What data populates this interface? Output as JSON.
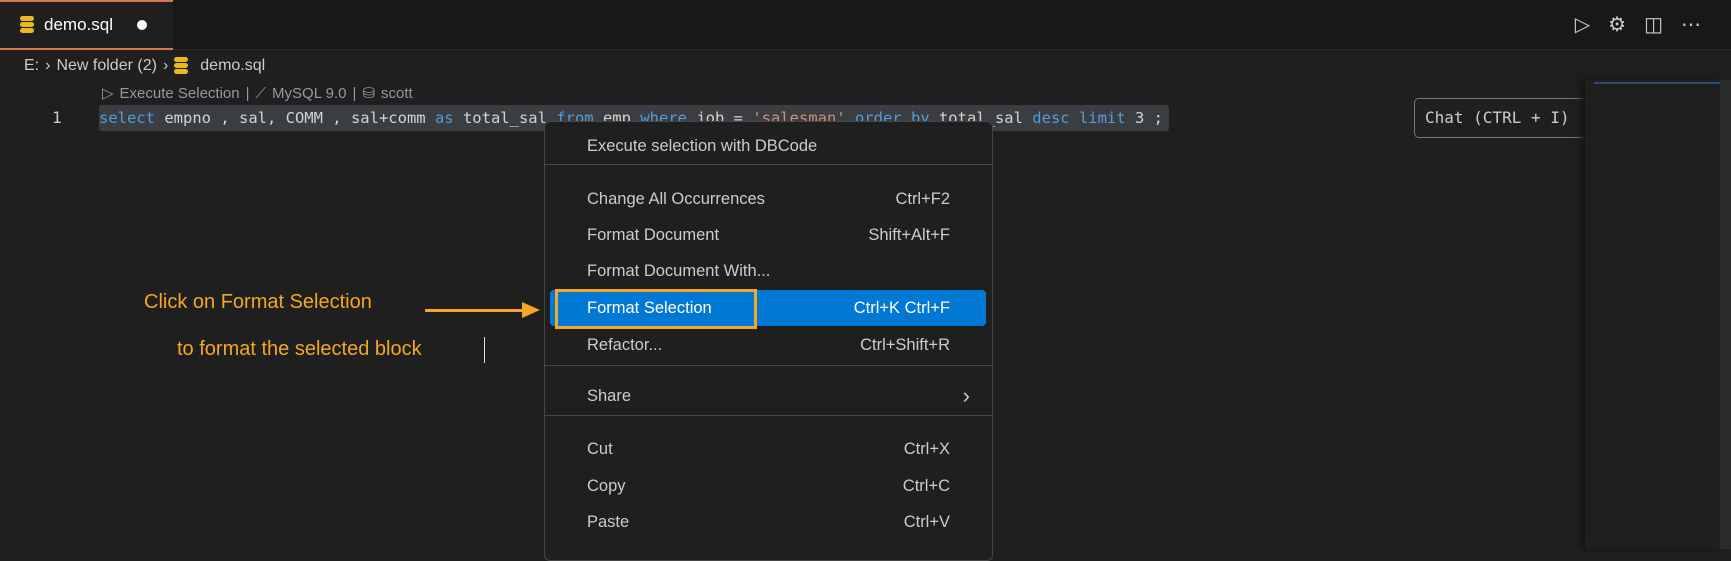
{
  "tab": {
    "title": "demo.sql",
    "icon": "database-icon",
    "modified": true
  },
  "actions": {
    "run": "play-icon",
    "settings": "gear-icon",
    "split": "split-editor-icon",
    "more": "more-icon"
  },
  "breadcrumb": [
    "E:",
    "New folder (2)",
    "demo.sql"
  ],
  "codelens": {
    "execute": "Execute Selection",
    "db": "MySQL 9.0",
    "user": "scott"
  },
  "editor": {
    "line_number": "1",
    "tokens": [
      [
        "kw",
        "select"
      ],
      [
        "id",
        " empno , sal, COMM , sal+comm "
      ],
      [
        "kw",
        "as"
      ],
      [
        "id",
        " total_sal "
      ],
      [
        "kw",
        "from"
      ],
      [
        "id",
        " emp "
      ],
      [
        "kw",
        "where"
      ],
      [
        "id",
        " job = "
      ],
      [
        "str",
        "'salesman'"
      ],
      [
        "id",
        " "
      ],
      [
        "kw",
        "order by"
      ],
      [
        "id",
        " total_sal "
      ],
      [
        "kw",
        "desc limit"
      ],
      [
        "id",
        " 3 ;"
      ]
    ]
  },
  "chat_hint": "Chat (CTRL + I)",
  "menu": {
    "items": [
      {
        "label": "Execute selection with DBCode",
        "shortcut": ""
      },
      {
        "label": "Change All Occurrences",
        "shortcut": "Ctrl+F2"
      },
      {
        "label": "Format Document",
        "shortcut": "Shift+Alt+F"
      },
      {
        "label": "Format Document With...",
        "shortcut": ""
      },
      {
        "label": "Format Selection",
        "shortcut": "Ctrl+K Ctrl+F"
      },
      {
        "label": "Refactor...",
        "shortcut": "Ctrl+Shift+R"
      },
      {
        "label": "Share",
        "shortcut": "›"
      },
      {
        "label": "Cut",
        "shortcut": "Ctrl+X"
      },
      {
        "label": "Copy",
        "shortcut": "Ctrl+C"
      },
      {
        "label": "Paste",
        "shortcut": "Ctrl+V"
      }
    ],
    "active_index": 4
  },
  "annotation": {
    "line1": "Click on Format Selection",
    "line2": "to format the selected block",
    "color": "#f5a623"
  }
}
